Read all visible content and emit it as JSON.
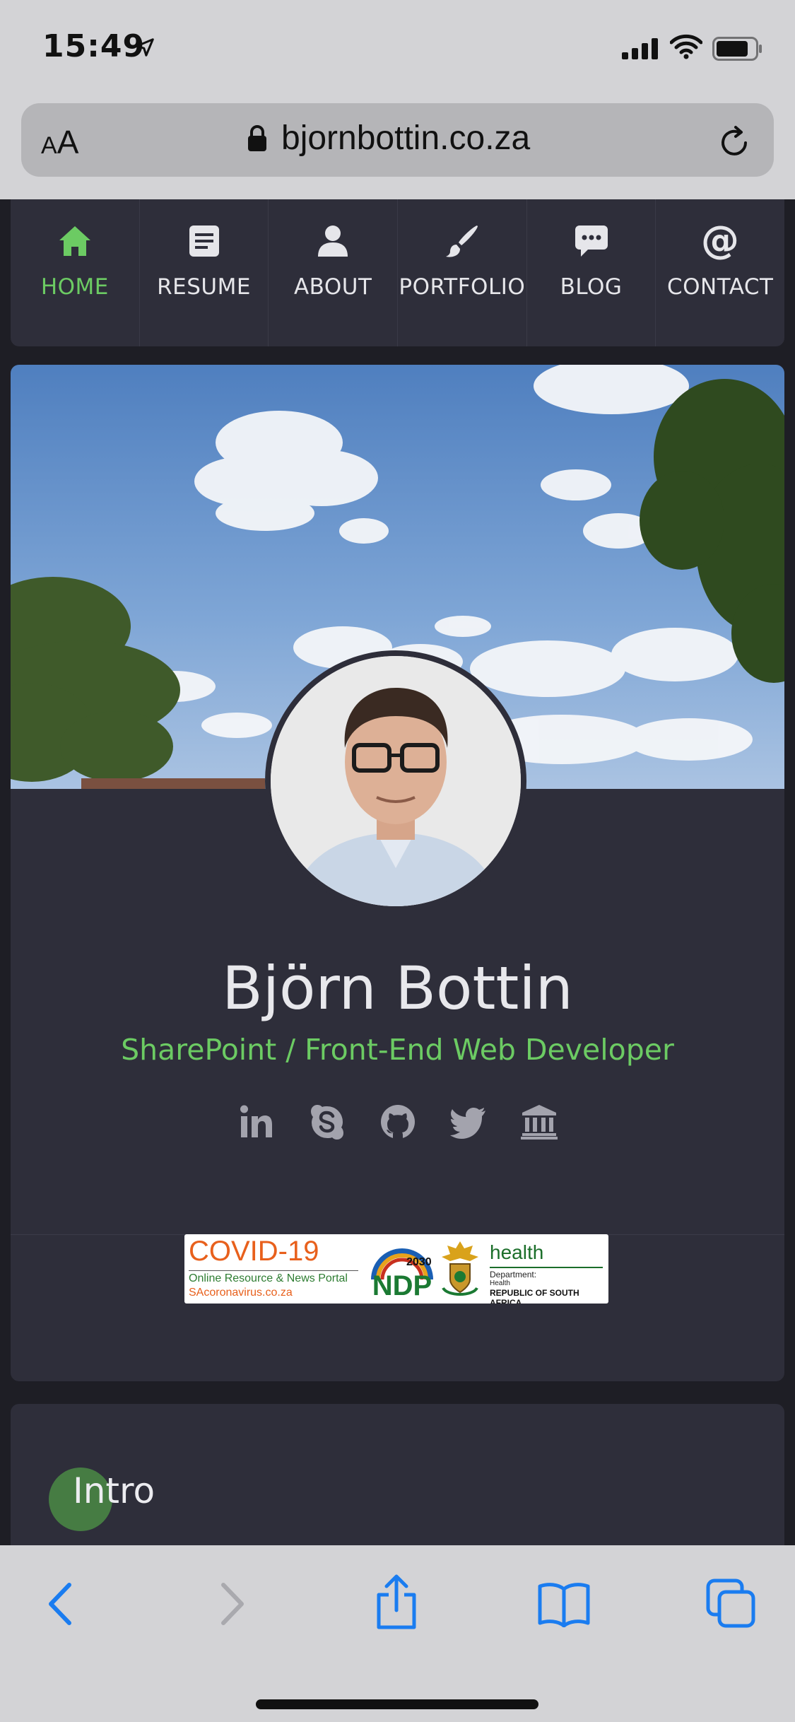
{
  "status_bar": {
    "time": "15:49"
  },
  "browser": {
    "text_size_label_small": "A",
    "text_size_label_large": "A",
    "url": "bjornbottin.co.za"
  },
  "nav": {
    "items": [
      {
        "label": "HOME",
        "icon": "home-icon",
        "active": true
      },
      {
        "label": "RESUME",
        "icon": "document-icon",
        "active": false
      },
      {
        "label": "ABOUT",
        "icon": "user-icon",
        "active": false
      },
      {
        "label": "PORTFOLIO",
        "icon": "paintbrush-icon",
        "active": false
      },
      {
        "label": "BLOG",
        "icon": "chat-icon",
        "active": false
      },
      {
        "label": "CONTACT",
        "icon": "at-icon",
        "active": false
      }
    ]
  },
  "profile": {
    "name": "Björn Bottin",
    "title": "SharePoint / Front-End Web Developer",
    "social": [
      "linkedin-icon",
      "skype-icon",
      "github-icon",
      "twitter-icon",
      "bank-icon"
    ]
  },
  "covid_banner": {
    "heading": "COVID-19",
    "portal": "Online Resource & News Portal",
    "site": "SAcoronavirus.co.za",
    "ndp_year": "2030",
    "ndp": "NDP",
    "health": "health",
    "department": "Department:",
    "department_name": "Health",
    "country": "REPUBLIC OF SOUTH AFRICA"
  },
  "intro": {
    "title": "Intro"
  },
  "colors": {
    "accent": "#6ccb63",
    "card": "#2e2e3a",
    "background": "#1e1e25",
    "chrome": "#d3d3d6",
    "ios_blue": "#1a7cf0"
  }
}
